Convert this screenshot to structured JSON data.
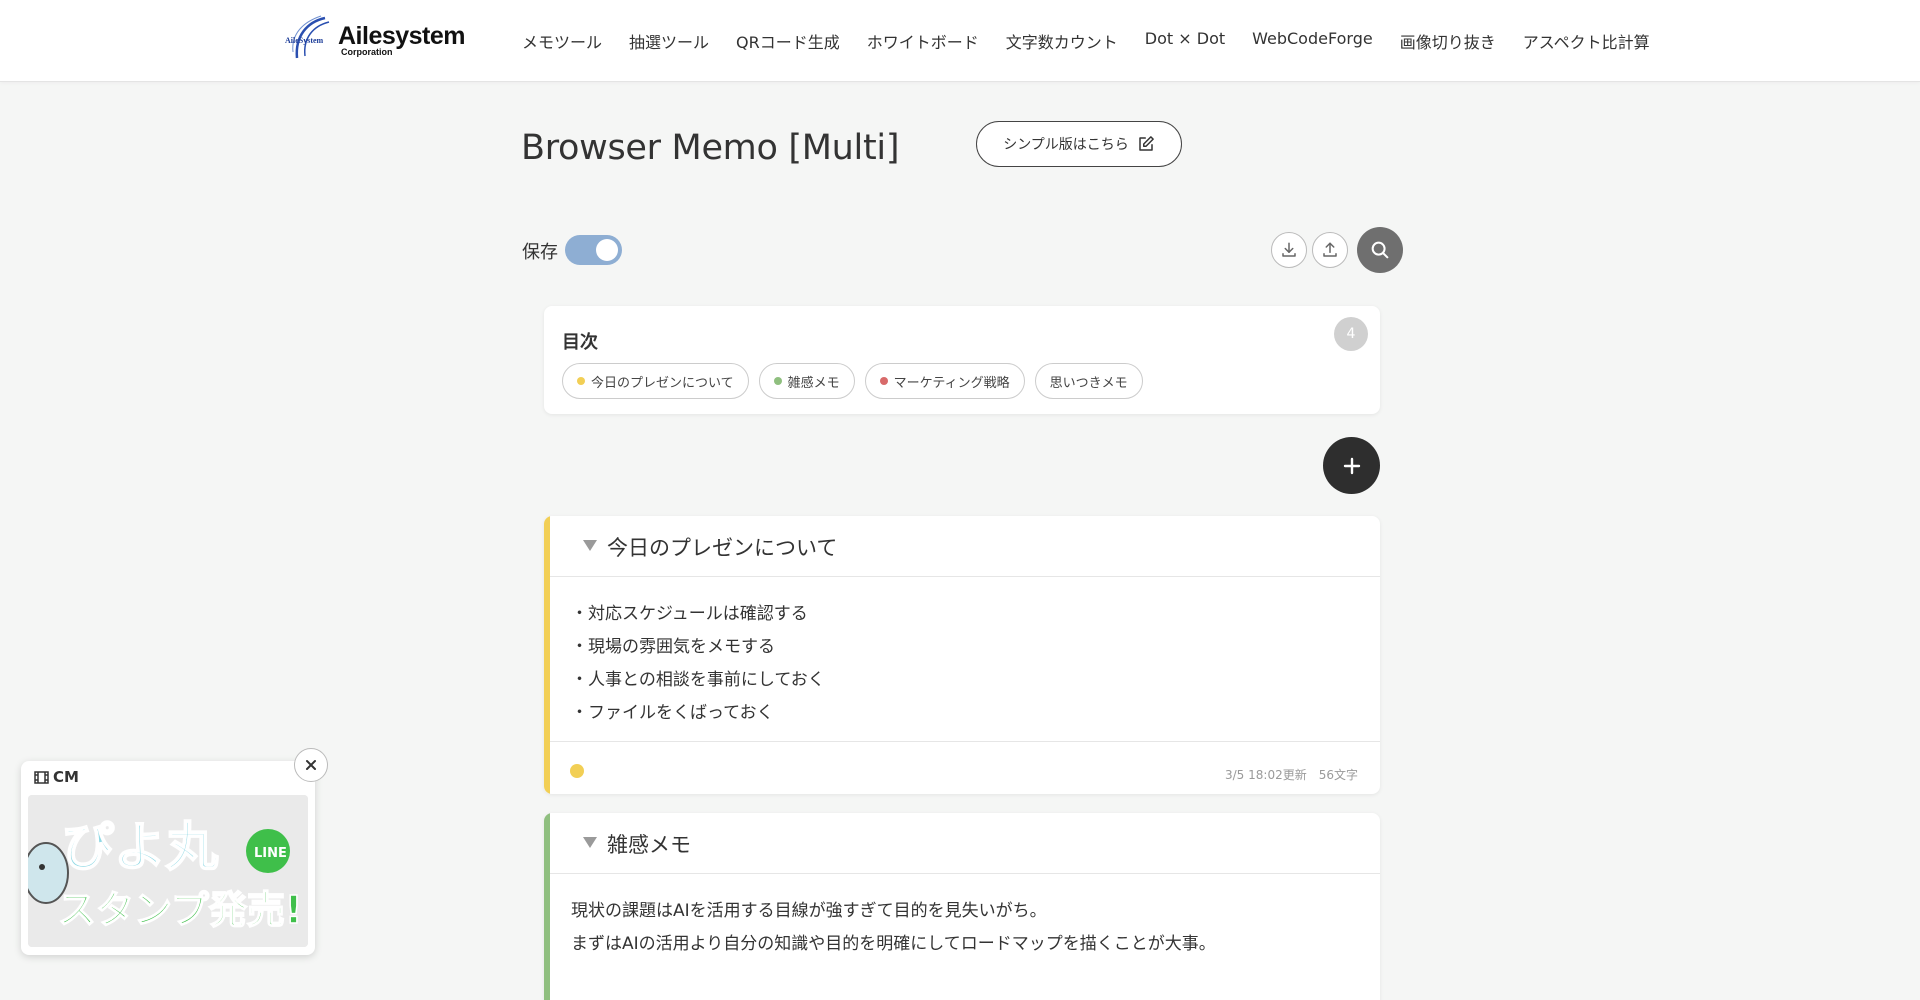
{
  "header": {
    "logo_text": "Ailesystem",
    "logo_sub": "Corporation",
    "logo_small": "AileSystem",
    "nav": [
      "メモツール",
      "抽選ツール",
      "QRコード生成",
      "ホワイトボード",
      "文字数カウント",
      "Dot × Dot",
      "WebCodeForge",
      "画像切り抜き",
      "アスペクト比計算"
    ]
  },
  "page": {
    "title": "Browser Memo [Multi]",
    "simple_button_label": "シンプル版はこちら",
    "save_label": "保存",
    "save_enabled": true
  },
  "toc": {
    "title": "目次",
    "count": "4",
    "items": [
      {
        "label": "今日のプレゼンについて",
        "color": "#f2cf55"
      },
      {
        "label": "雑感メモ",
        "color": "#8fbf7f"
      },
      {
        "label": "マーケティング戦略",
        "color": "#d86a6a"
      },
      {
        "label": "思いつきメモ",
        "color": ""
      }
    ]
  },
  "memos": [
    {
      "title": "今日のプレゼンについて",
      "color": "#f2cf55",
      "body": "・対応スケジュールは確認する\n・現場の雰囲気をメモする\n・人事との相談を事前にしておく\n・ファイルをくばっておく",
      "updated": "3/5 18:02更新",
      "chars": "56文字"
    },
    {
      "title": "雑感メモ",
      "color": "#8fbf7f",
      "body": "現状の課題はAIを活用する目線が強すぎて目的を見失いがち。\nまずはAIの活用より自分の知識や目的を明確にしてロードマップを描くことが大事。"
    }
  ],
  "cm": {
    "label": "CM",
    "banner_line1": "ぴよ丸",
    "banner_line2": "スタンプ発売!",
    "banner_badge": "LINE"
  },
  "colors": {
    "toggle_on": "#8eaed3",
    "add_button": "#2e2e2e",
    "search_button": "#6f6f6f"
  }
}
